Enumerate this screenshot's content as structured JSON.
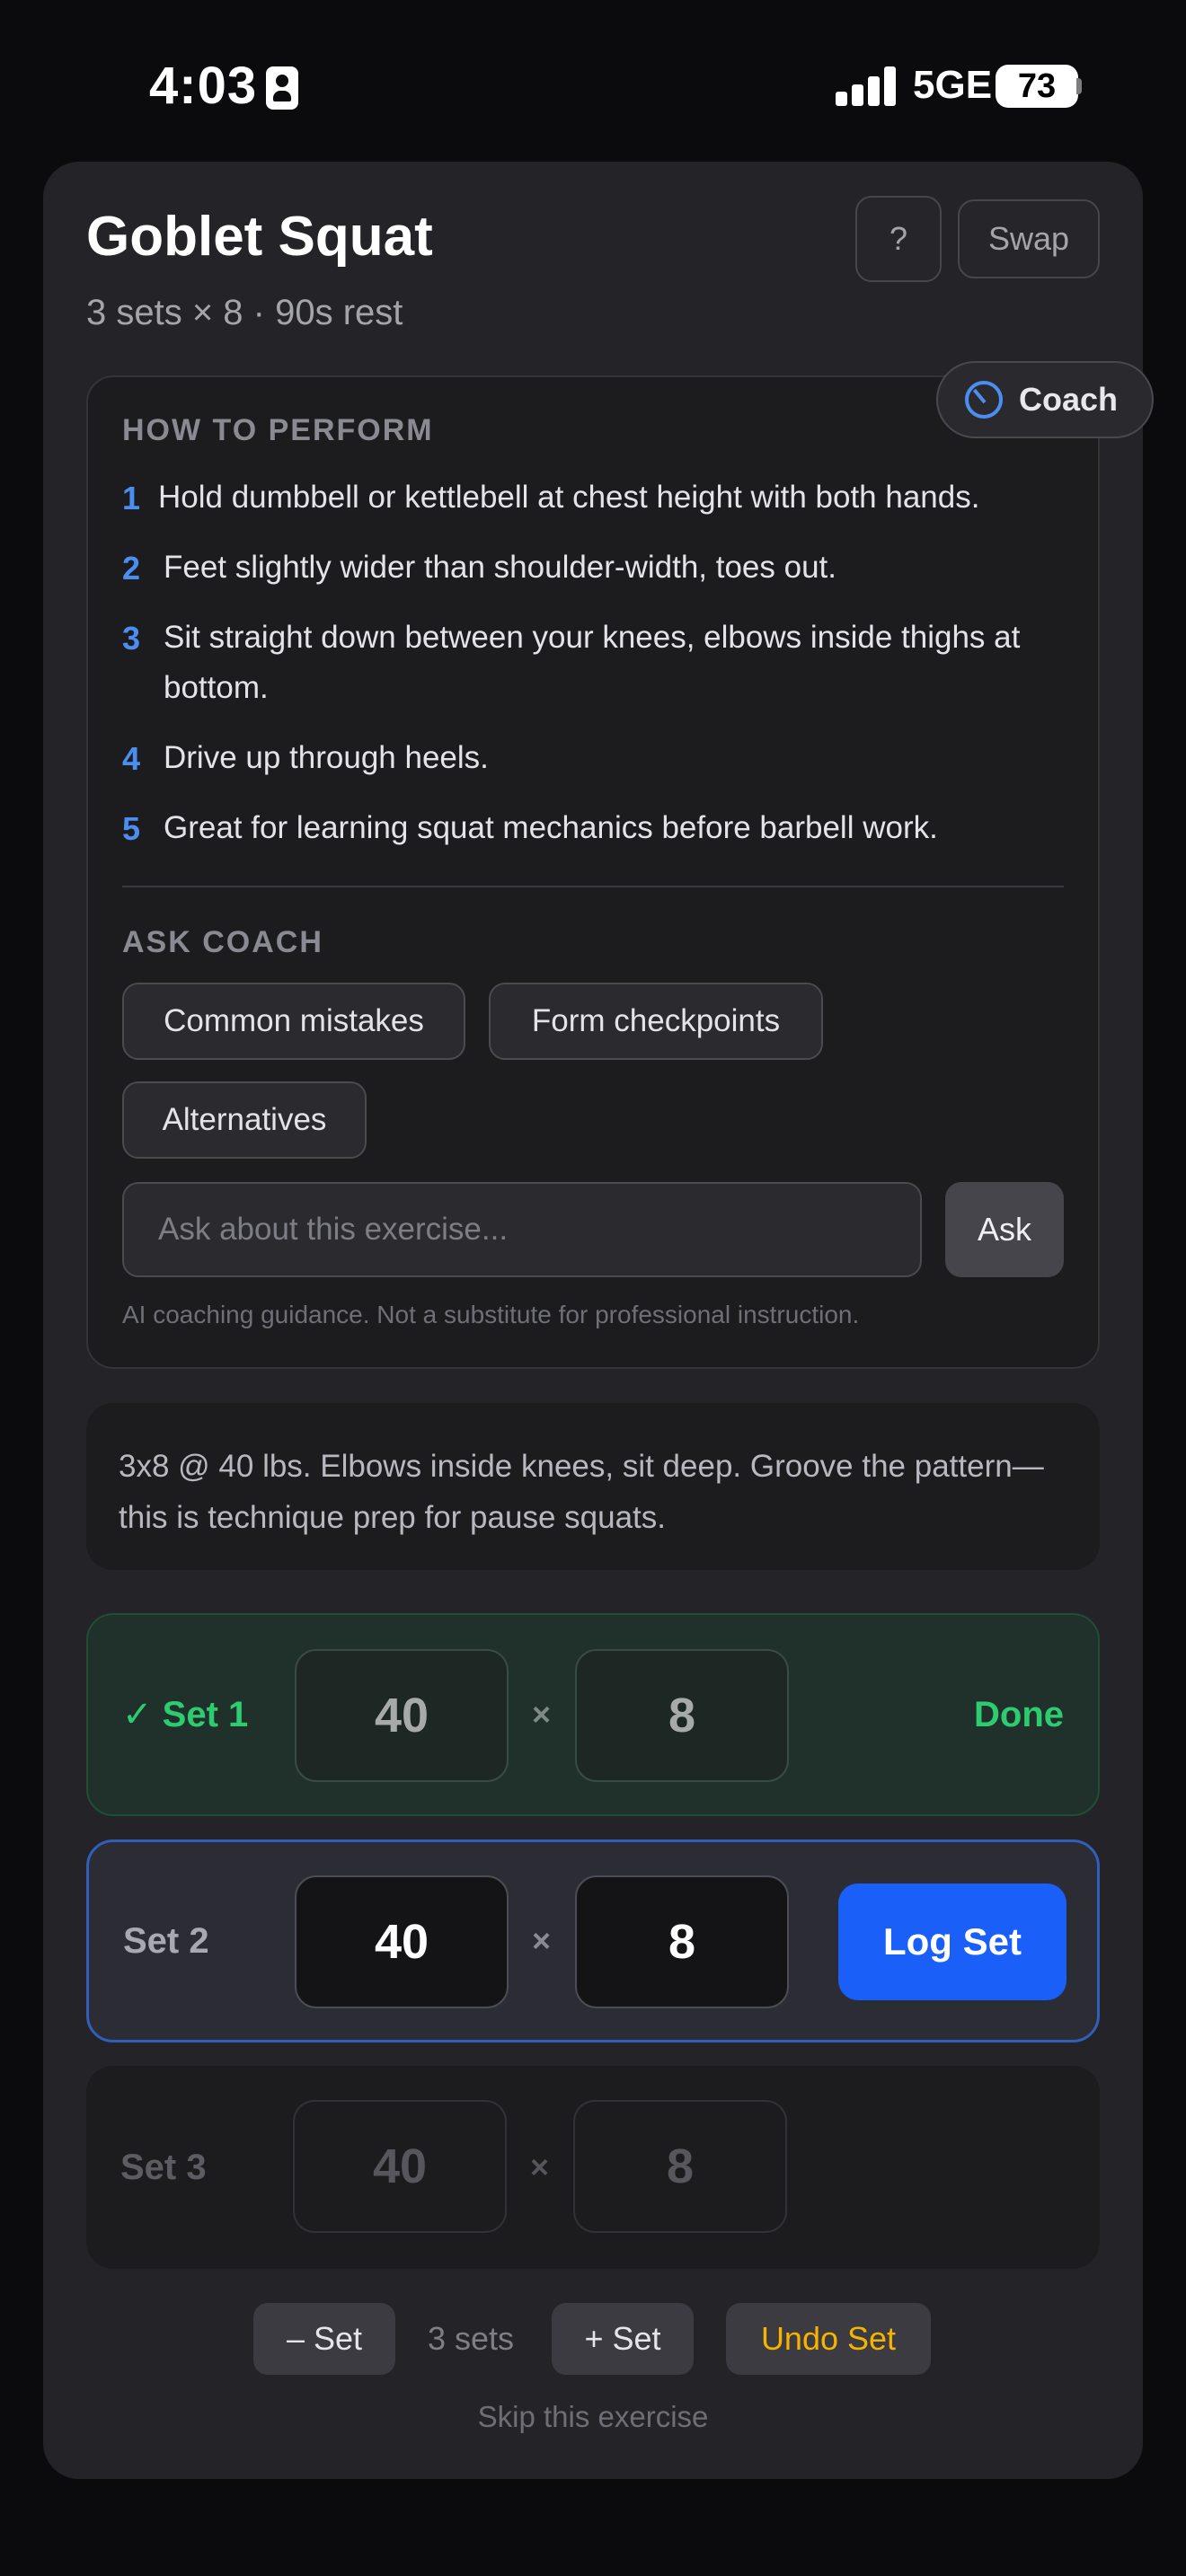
{
  "status_bar": {
    "time": "4:03",
    "network": "5GE",
    "battery": "73"
  },
  "exercise": {
    "title": "Goblet Squat",
    "subtitle": "3 sets × 8 · 90s rest",
    "help_label": "?",
    "swap_label": "Swap",
    "coach_label": "Coach"
  },
  "how_to": {
    "heading": "HOW TO PERFORM",
    "steps": [
      {
        "num": "1",
        "text": "Hold dumbbell or kettlebell at chest height with both hands."
      },
      {
        "num": "2",
        "text": "Feet slightly wider than shoulder-width, toes out."
      },
      {
        "num": "3",
        "text": "Sit straight down between your knees, elbows inside thighs at bottom."
      },
      {
        "num": "4",
        "text": "Drive up through heels."
      },
      {
        "num": "5",
        "text": "Great for learning squat mechanics before barbell work."
      }
    ]
  },
  "ask_coach": {
    "heading": "ASK COACH",
    "chips": [
      "Common mistakes",
      "Form checkpoints",
      "Alternatives"
    ],
    "input_placeholder": "Ask about this exercise...",
    "ask_label": "Ask",
    "disclaimer": "AI coaching guidance. Not a substitute for professional instruction."
  },
  "note": "3x8 @ 40 lbs. Elbows inside knees, sit deep. Groove the pattern—this is technique prep for pause squats.",
  "sets": [
    {
      "label": "Set 1",
      "check": "✓",
      "weight": "40",
      "reps": "8",
      "times": "×",
      "status": "Done"
    },
    {
      "label": "Set 2",
      "weight": "40",
      "reps": "8",
      "times": "×",
      "action": "Log Set"
    },
    {
      "label": "Set 3",
      "weight": "40",
      "reps": "8",
      "times": "×"
    }
  ],
  "controls": {
    "minus_set": "– Set",
    "sets_count": "3 sets",
    "plus_set": "+ Set",
    "undo_set": "Undo Set",
    "skip": "Skip this exercise"
  },
  "colors": {
    "accent_blue": "#1a5ff8",
    "done_green": "#2ecc71",
    "undo_amber": "#f5b400",
    "step_number_blue": "#4c8ef0"
  }
}
